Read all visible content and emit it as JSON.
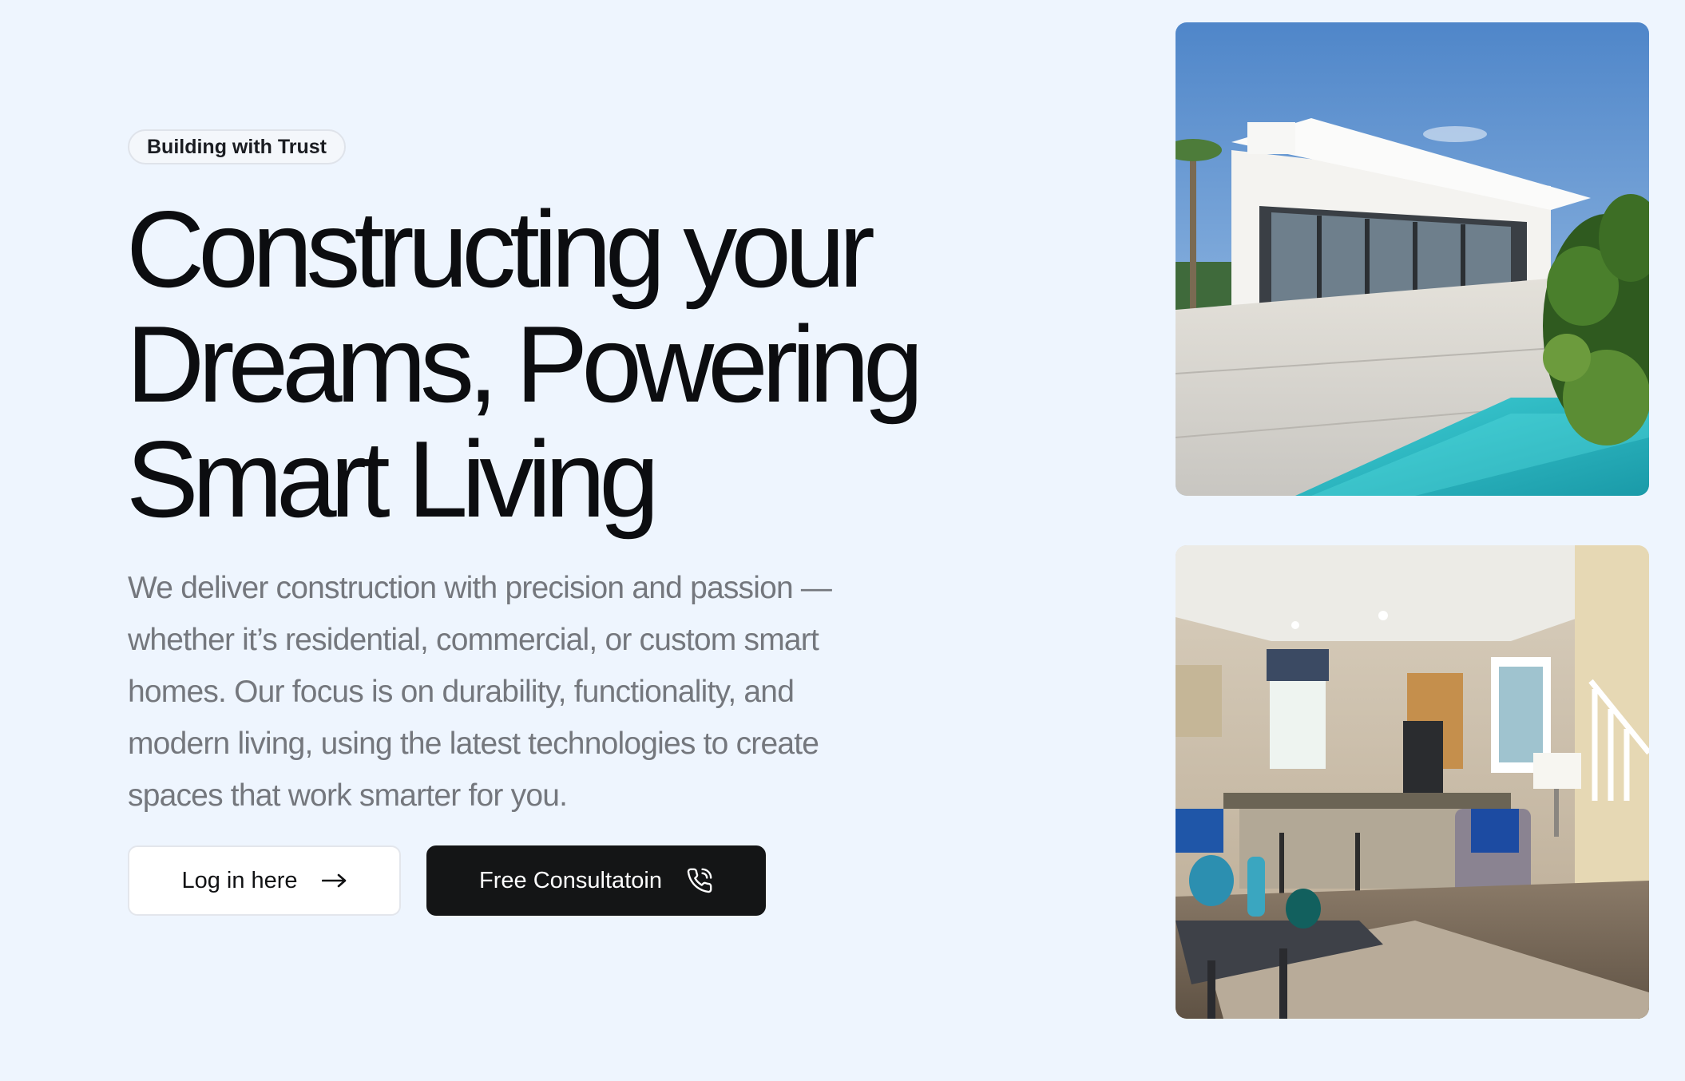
{
  "hero": {
    "badge": "Building with Trust",
    "headline": {
      "line1": "Constructing your",
      "line2": "Dreams, Powering",
      "line3": "Smart Living"
    },
    "description": "We deliver construction with precision and passion — whether it’s residential, commercial, or custom smart homes. Our focus is on durability, functionality, and modern living, using the latest technologies to create spaces that work smarter for you.",
    "buttons": {
      "login": {
        "label": "Log in here",
        "icon": "arrow-right-icon"
      },
      "consult": {
        "label": "Free Consultatoin",
        "icon": "phone-call-icon"
      }
    }
  },
  "gallery": {
    "images": [
      {
        "subject": "modern white villa exterior with pool"
      },
      {
        "subject": "open-plan living room with kitchen"
      }
    ]
  },
  "colors": {
    "background": "#eef5fe",
    "text_primary": "#0c0d10",
    "text_muted": "#74777d",
    "button_dark": "#141516",
    "button_light": "#ffffff"
  }
}
